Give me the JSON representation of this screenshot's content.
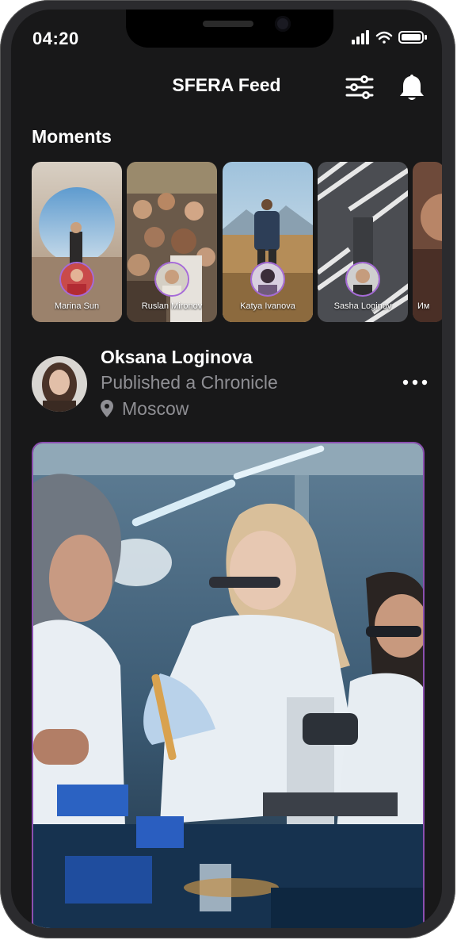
{
  "status_bar": {
    "time": "04:20"
  },
  "header": {
    "title": "SFERA Feed",
    "filter_icon": "sliders-icon",
    "notification_icon": "bell-icon"
  },
  "moments": {
    "title": "Moments",
    "items": [
      {
        "name": "Marina Sun"
      },
      {
        "name": "Ruslan Mironov"
      },
      {
        "name": "Katya Ivanova"
      },
      {
        "name": "Sasha Loginov"
      },
      {
        "name": "Им"
      }
    ]
  },
  "post": {
    "author": "Oksana Loginova",
    "action": "Published a Chronicle",
    "location": "Moscow",
    "more_icon": "more-dots-icon"
  },
  "colors": {
    "background": "#181819",
    "accent": "#8b4fb0",
    "muted_text": "#8f8f94"
  }
}
